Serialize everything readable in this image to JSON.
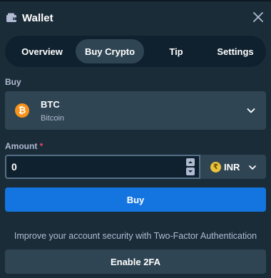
{
  "header": {
    "title": "Wallet",
    "wallet_icon": "wallet-icon",
    "close_icon": "close-icon"
  },
  "tabs": [
    {
      "label": "Overview",
      "active": false
    },
    {
      "label": "Buy Crypto",
      "active": true
    },
    {
      "label": "Tip",
      "active": false
    },
    {
      "label": "Settings",
      "active": false
    }
  ],
  "buy": {
    "label": "Buy",
    "coin_code": "BTC",
    "coin_name": "Bitcoin",
    "coin_symbol": "₿",
    "coin_color": "#f7931a"
  },
  "amount": {
    "label": "Amount",
    "required_mark": "*",
    "value": "0",
    "currency_code": "INR",
    "currency_symbol": "₹"
  },
  "buy_button": {
    "label": "Buy"
  },
  "security": {
    "message": "Improve your account security with Two-Factor Authentication",
    "button_label": "Enable 2FA"
  },
  "colors": {
    "background": "#1a2c38",
    "tab_bar": "#0f212e",
    "active_tab": "#2f4553",
    "primary": "#1475e1",
    "required": "#ed4163"
  }
}
